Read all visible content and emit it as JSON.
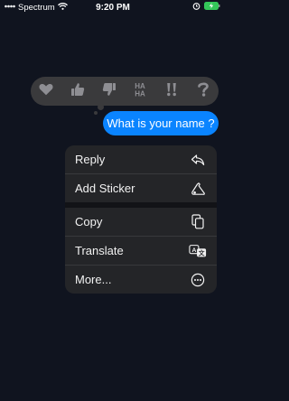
{
  "status_bar": {
    "carrier": "Spectrum",
    "time": "9:20 PM"
  },
  "reactions": [
    {
      "icon": "heart-icon"
    },
    {
      "icon": "thumbs-up-icon"
    },
    {
      "icon": "thumbs-down-icon"
    },
    {
      "icon": "haha-icon",
      "text": "HA HA"
    },
    {
      "icon": "exclamation-icon"
    },
    {
      "icon": "question-icon"
    }
  ],
  "message": {
    "text": "What is your name ?"
  },
  "menu": {
    "items": [
      {
        "label": "Reply",
        "icon": "reply-icon"
      },
      {
        "label": "Add Sticker",
        "icon": "sticker-icon"
      },
      {
        "label": "Copy",
        "icon": "copy-icon"
      },
      {
        "label": "Translate",
        "icon": "translate-icon"
      },
      {
        "label": "More...",
        "icon": "more-icon"
      }
    ]
  },
  "colors": {
    "background": "#10141f",
    "bubble": "#0a84ff",
    "menu": "#242528",
    "reaction_bar": "#3a3a3c",
    "reaction_icon": "#8e8e93"
  }
}
